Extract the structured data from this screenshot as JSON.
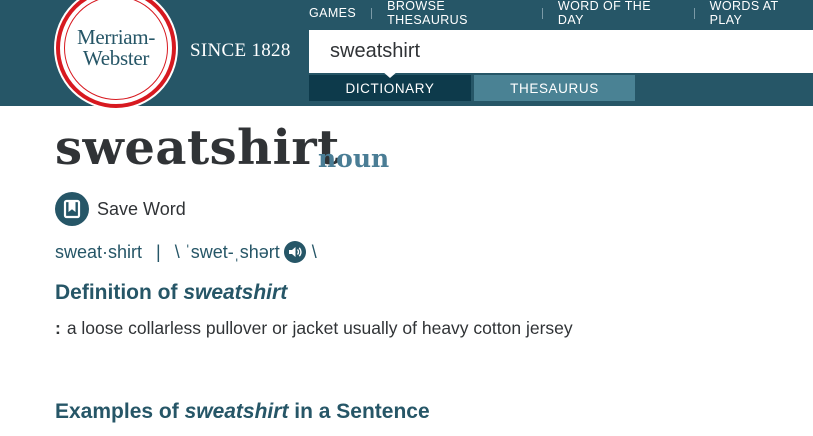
{
  "header": {
    "logo_line1": "Merriam-",
    "logo_line2": "Webster",
    "since": "SINCE 1828",
    "nav": [
      "GAMES",
      "BROWSE THESAURUS",
      "WORD OF THE DAY",
      "WORDS AT PLAY"
    ],
    "search_value": "sweatshirt",
    "tabs": {
      "dictionary": "DICTIONARY",
      "thesaurus": "THESAURUS"
    }
  },
  "entry": {
    "headword": "sweatshirt",
    "part_of_speech": "noun",
    "save_label": "Save Word",
    "syllables": "sweat·shirt",
    "separator": "|",
    "pron_open": "\\ ˈswet-ˌshərt",
    "pron_close": "\\",
    "definition_heading_prefix": "Definition of ",
    "definition_heading_word": "sweatshirt",
    "definition_colon": ":",
    "definition_text": "a loose collarless pullover or jacket usually of heavy cotton jersey",
    "examples_heading_prefix": "Examples of ",
    "examples_heading_word": "sweatshirt",
    "examples_heading_suffix": " in a Sentence"
  },
  "colors": {
    "header_bg": "#265667",
    "active_tab": "#0d3a4b",
    "inactive_tab": "#4a8294",
    "logo_red": "#d71920",
    "heading_teal": "#265667"
  },
  "icons": {
    "save": "bookmark-icon",
    "audio": "speaker-icon"
  }
}
